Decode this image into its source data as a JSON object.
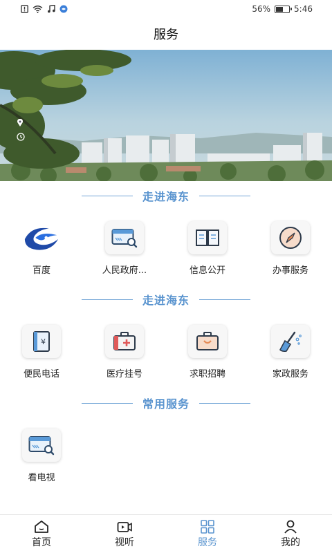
{
  "status_bar": {
    "battery": "56%",
    "battery_level": 0.56,
    "time": "5:46",
    "icons": [
      "sim-alert-icon",
      "wifi-icon",
      "music-icon",
      "app-icon"
    ]
  },
  "header": {
    "title": "服务"
  },
  "sections": [
    {
      "title": "走进海东",
      "items": [
        {
          "label": "百度",
          "icon": "baidu-logo-icon"
        },
        {
          "label": "人民政府...",
          "icon": "card-search-icon"
        },
        {
          "label": "信息公开",
          "icon": "book-icon"
        },
        {
          "label": "办事服务",
          "icon": "compass-icon"
        }
      ]
    },
    {
      "title": "走进海东",
      "items": [
        {
          "label": "便民电话",
          "icon": "phone-book-icon"
        },
        {
          "label": "医疗挂号",
          "icon": "medical-kit-icon"
        },
        {
          "label": "求职招聘",
          "icon": "briefcase-icon"
        },
        {
          "label": "家政服务",
          "icon": "broom-icon"
        }
      ]
    },
    {
      "title": "常用服务",
      "items": [
        {
          "label": "看电视",
          "icon": "tv-card-icon"
        }
      ]
    }
  ],
  "bottom_nav": [
    {
      "label": "首页",
      "icon": "home-icon",
      "active": false
    },
    {
      "label": "视听",
      "icon": "video-icon",
      "active": false
    },
    {
      "label": "服务",
      "icon": "grid-icon",
      "active": true
    },
    {
      "label": "我的",
      "icon": "user-icon",
      "active": false
    }
  ],
  "colors": {
    "accent": "#5a94cf",
    "section_line": "#6fa3d6"
  }
}
